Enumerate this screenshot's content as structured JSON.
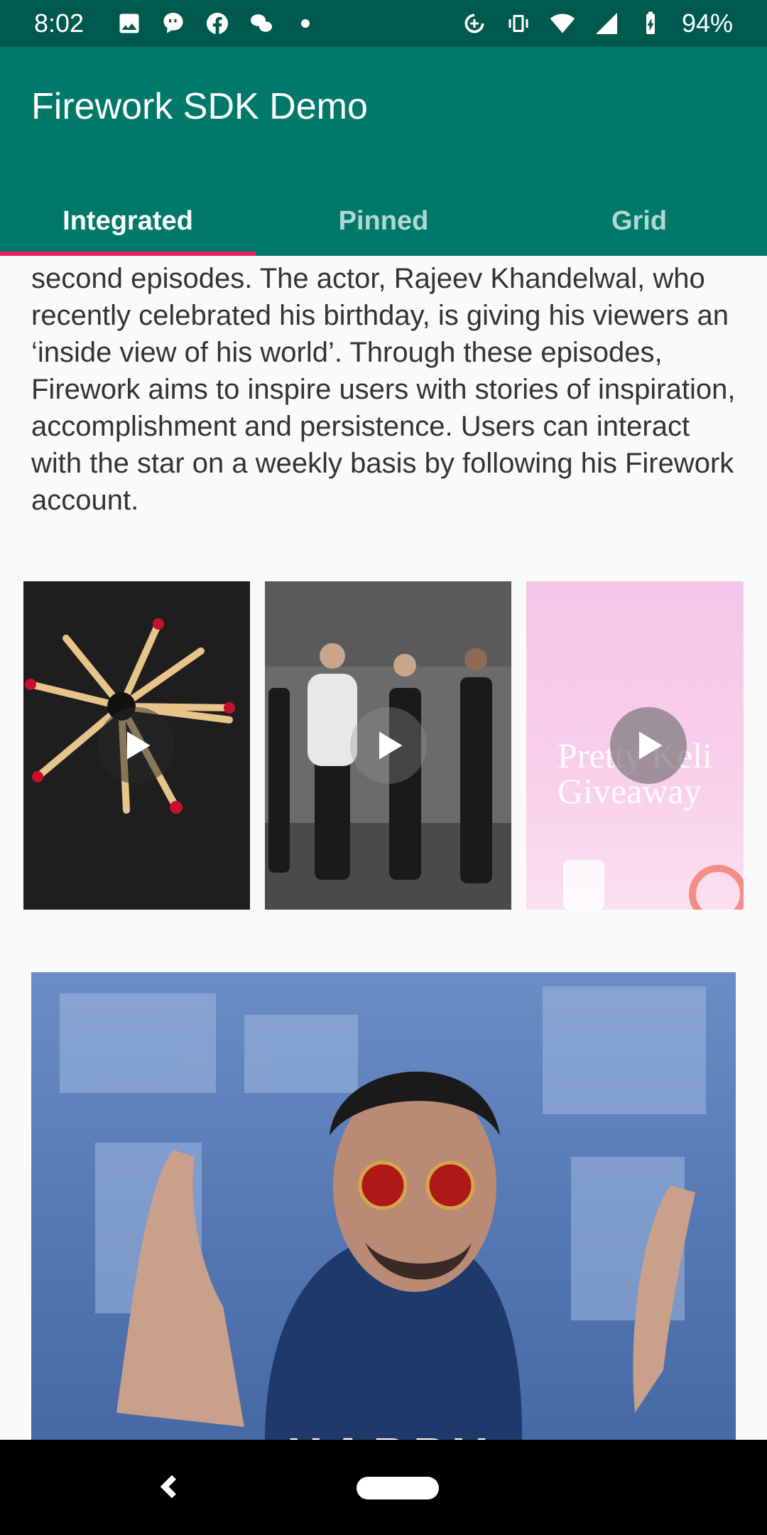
{
  "status_bar": {
    "time": "8:02",
    "battery": "94%",
    "left_icons": [
      "image-icon",
      "message-bubble-icon",
      "facebook-icon",
      "wechat-icon",
      "dot-icon"
    ],
    "right_icons": [
      "data-saver-icon",
      "vibrate-icon",
      "wifi-icon",
      "signal-icon",
      "battery-charging-icon"
    ]
  },
  "app_bar": {
    "title": "Firework SDK Demo",
    "color": "#00796b",
    "indicator_color": "#e91e63"
  },
  "tabs": [
    {
      "label": "Integrated",
      "active": true
    },
    {
      "label": "Pinned",
      "active": false
    },
    {
      "label": "Grid",
      "active": false
    }
  ],
  "article": {
    "text": "second episodes. The actor, Rajeev Khandelwal, who recently celebrated his birthday, is giving his viewers an ‘inside view of his world’. Through these episodes, Firework aims to inspire users with stories of inspiration, accomplishment and persistence. Users can interact with the star on a weekly basis by following his Firework account."
  },
  "video_thumbnails": [
    {
      "subject": "matchsticks",
      "icon": "play-icon"
    },
    {
      "subject": "dancers",
      "icon": "play-icon"
    },
    {
      "subject": "promo",
      "icon": "play-icon",
      "overlay_text": "Pretty Keli Giveaway"
    }
  ],
  "feature_video": {
    "caption": "HAPPY"
  },
  "nav_bar": {
    "icons": [
      "back-icon",
      "home-pill"
    ]
  }
}
